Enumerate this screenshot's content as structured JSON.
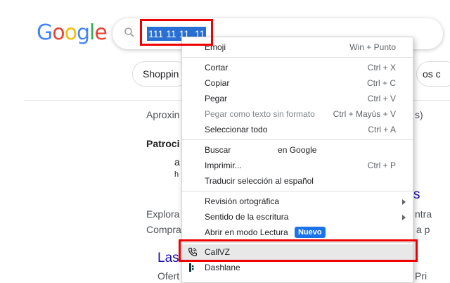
{
  "logo": {
    "text": [
      "G",
      "o",
      "o",
      "g",
      "l",
      "e"
    ],
    "colors": [
      "#4285F4",
      "#EA4335",
      "#FBBC05",
      "#4285F4",
      "#34A853",
      "#EA4335"
    ]
  },
  "search": {
    "query": "111 11 11  11",
    "icon": "search-icon"
  },
  "chips": {
    "shopping": "Shoppin",
    "right": "os c"
  },
  "background": {
    "approx": "Aproxin",
    "approx_right": "s)",
    "patroc": "Patroci",
    "frag_a": "a",
    "frag_h": "h",
    "frag_s": "s",
    "explora": "Explora",
    "explora_right": "ntra",
    "compra": "Compra",
    "compra_right": "a p",
    "las": "Las",
    "ofert": "Ofert",
    "ofert_right": "Pri"
  },
  "menu": {
    "emoji": {
      "label": "Emoji",
      "shortcut": "Win + Punto"
    },
    "cortar": {
      "label": "Cortar",
      "shortcut": "Ctrl + X"
    },
    "copiar": {
      "label": "Copiar",
      "shortcut": "Ctrl + C"
    },
    "pegar": {
      "label": "Pegar",
      "shortcut": "Ctrl + V"
    },
    "pegar_texto": {
      "label": "Pegar como texto sin formato",
      "shortcut": "Ctrl + Mayús + V"
    },
    "seleccionar": {
      "label": "Seleccionar todo",
      "shortcut": "Ctrl + A"
    },
    "buscar": {
      "label": "Buscar                    en Google"
    },
    "imprimir": {
      "label": "Imprimir...",
      "shortcut": "Ctrl + P"
    },
    "traducir": {
      "label": "Traducir selección al español"
    },
    "revision": {
      "label": "Revisión ortográfica"
    },
    "sentido": {
      "label": "Sentido de la escritura"
    },
    "lectura": {
      "label": "Abrir en modo Lectura",
      "badge": "Nuevo"
    },
    "callvz": {
      "label": "CallVZ",
      "icon": "phone-icon"
    },
    "dashlane": {
      "label": "Dashlane",
      "icon": "dashlane-icon"
    }
  }
}
